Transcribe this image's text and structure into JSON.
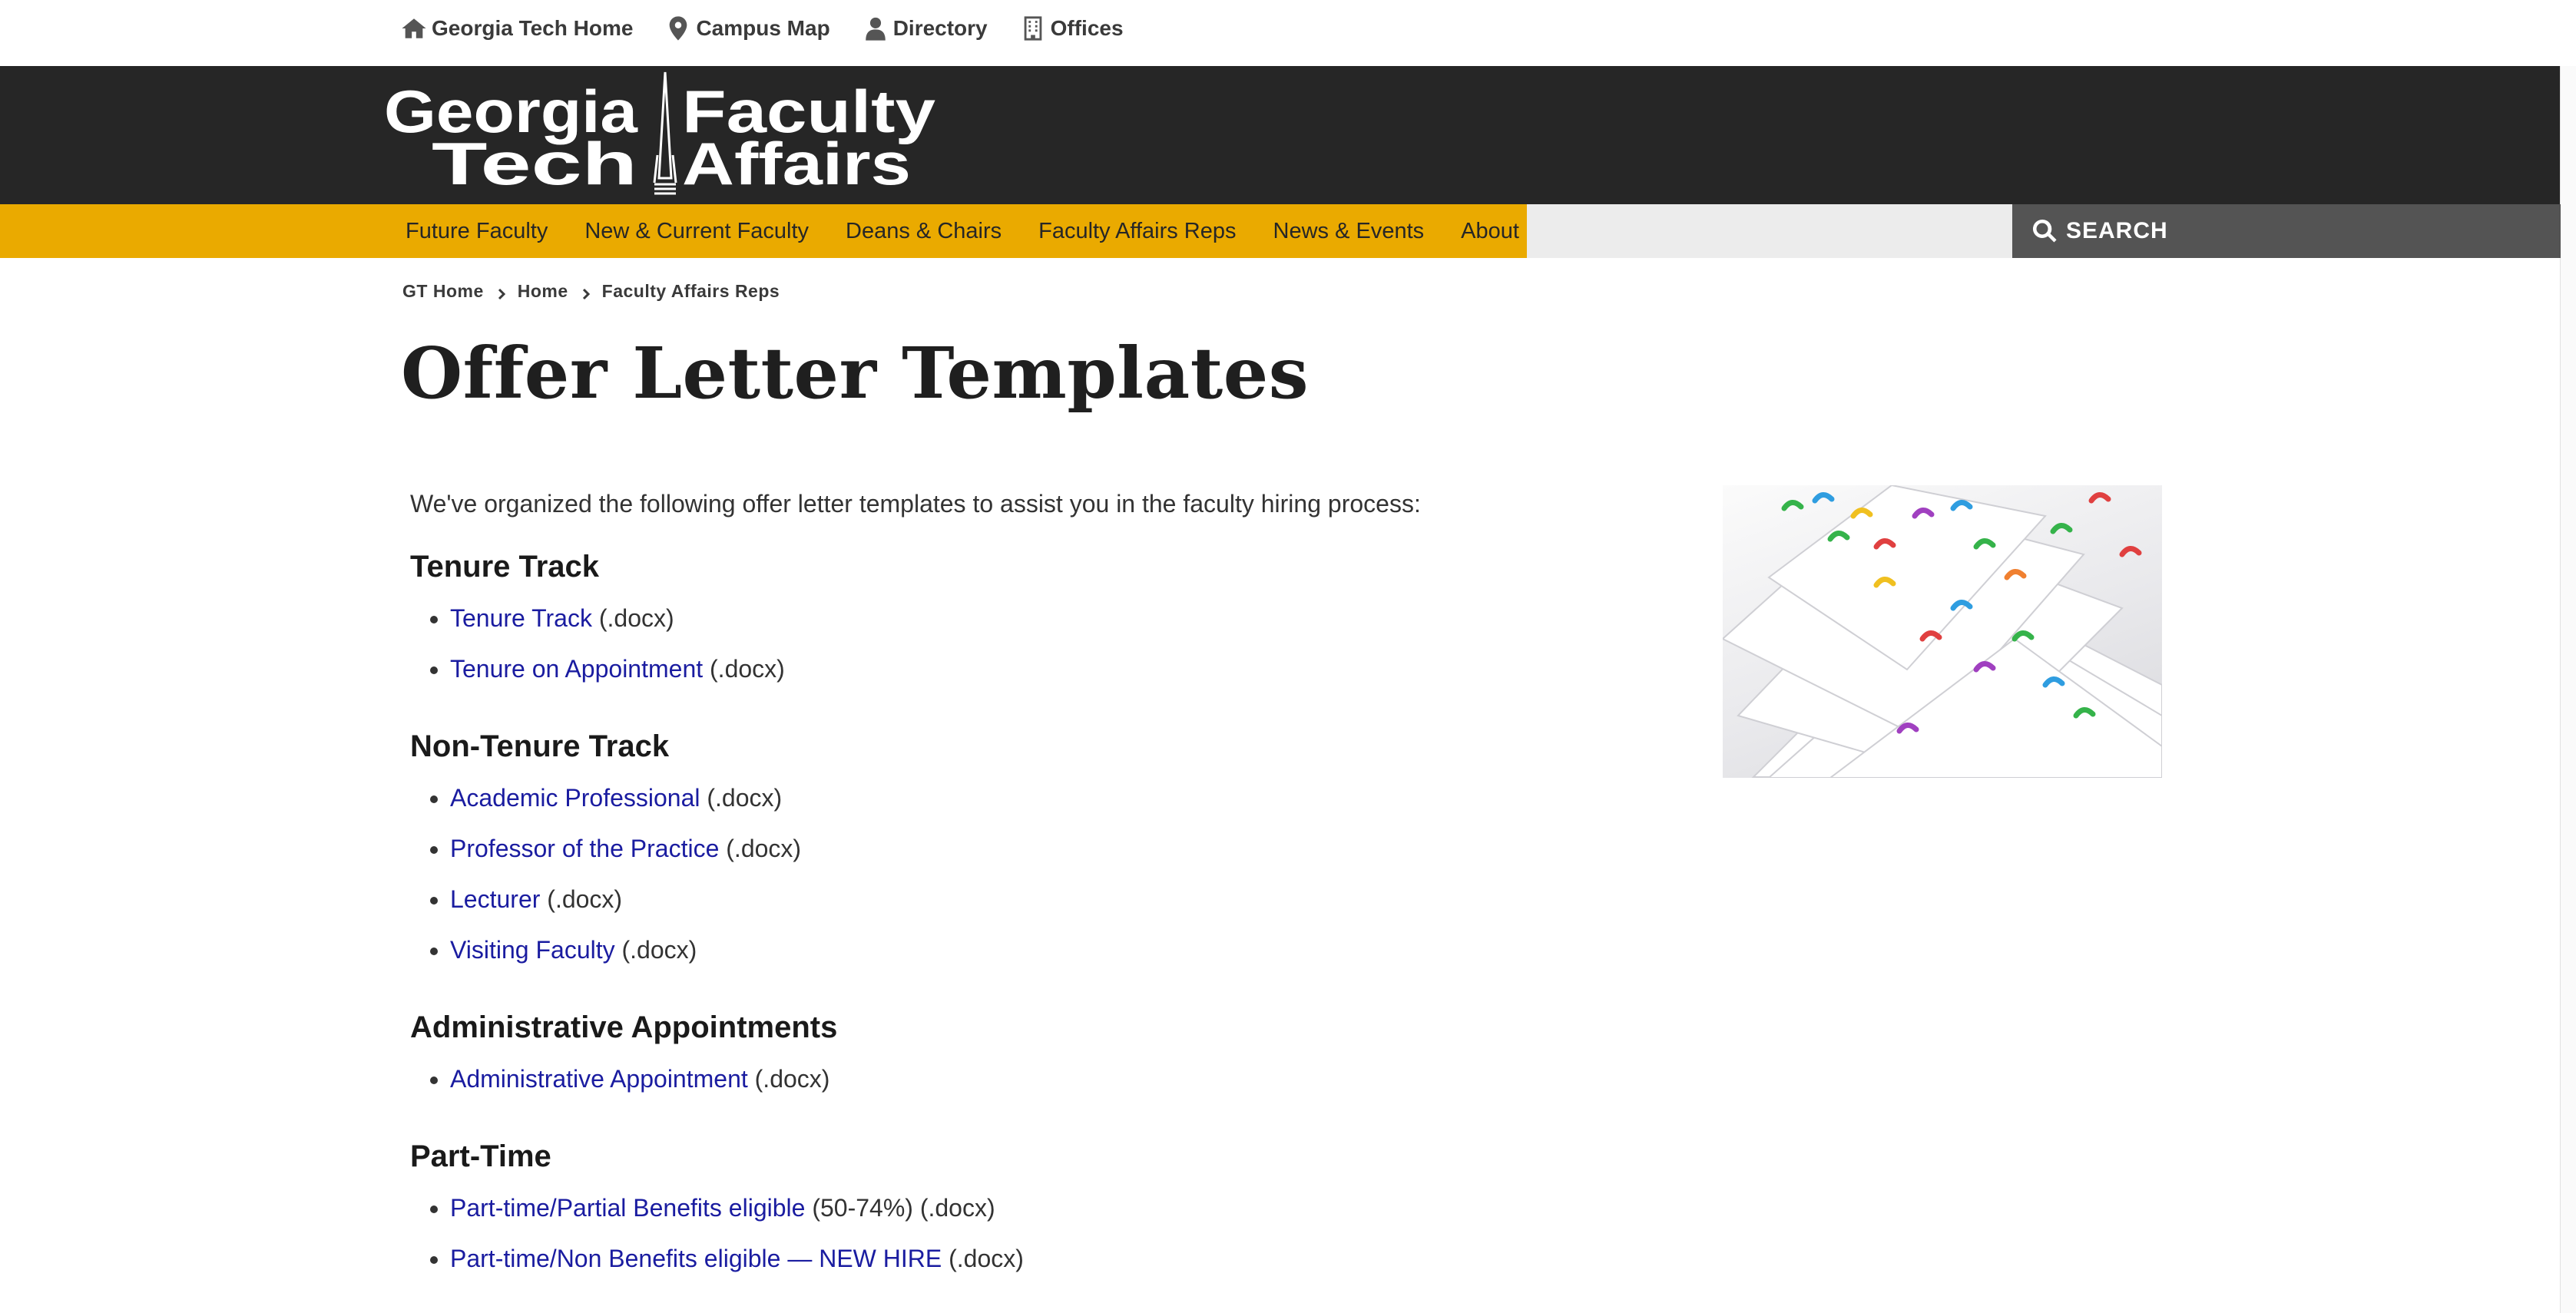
{
  "utility_nav": [
    {
      "label": "Georgia Tech Home",
      "icon": "home-icon"
    },
    {
      "label": "Campus Map",
      "icon": "map-pin-icon"
    },
    {
      "label": "Directory",
      "icon": "person-icon"
    },
    {
      "label": "Offices",
      "icon": "building-icon"
    }
  ],
  "logo": {
    "line1_left": "Georgia",
    "line2_left": "Tech",
    "line1_right": "Faculty",
    "line2_right": "Affairs"
  },
  "main_nav": [
    {
      "label": "Future Faculty"
    },
    {
      "label": "New & Current Faculty"
    },
    {
      "label": "Deans & Chairs"
    },
    {
      "label": "Faculty Affairs Reps"
    },
    {
      "label": "News & Events"
    },
    {
      "label": "About Us"
    }
  ],
  "search": {
    "button_label": "SEARCH"
  },
  "breadcrumb": [
    "GT Home",
    "Home",
    "Faculty Affairs Reps"
  ],
  "page": {
    "title": "Offer Letter Templates",
    "intro": "We've organized the following offer letter templates to assist you in the faculty hiring process:"
  },
  "sections": [
    {
      "heading": "Tenure Track",
      "items": [
        {
          "link": "Tenure Track",
          "suffix": " (.docx)"
        },
        {
          "link": "Tenure on Appointment",
          "suffix": " (.docx)"
        }
      ]
    },
    {
      "heading": "Non-Tenure Track",
      "items": [
        {
          "link": "Academic Professional",
          "suffix": " (.docx)"
        },
        {
          "link": "Professor of the Practice",
          "suffix": " (.docx)"
        },
        {
          "link": "Lecturer",
          "suffix": " (.docx)"
        },
        {
          "link": "Visiting Faculty",
          "suffix": " (.docx)"
        }
      ]
    },
    {
      "heading": "Administrative Appointments",
      "items": [
        {
          "link": "Administrative Appointment",
          "suffix": " (.docx)"
        }
      ]
    },
    {
      "heading": "Part-Time",
      "items": [
        {
          "link": "Part-time/Partial Benefits eligible",
          "suffix": " (50-74%) (.docx)"
        },
        {
          "link": "Part-time/Non Benefits eligible — NEW HIRE",
          "suffix": " (.docx)"
        }
      ]
    }
  ],
  "colors": {
    "gold": "#eaaa00",
    "header_black": "#262626",
    "link_blue": "#1a1ca0",
    "search_gray": "#545454"
  }
}
